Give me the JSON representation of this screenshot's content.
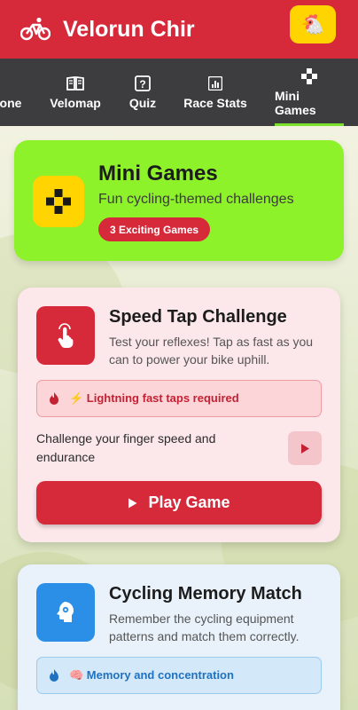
{
  "app": {
    "title": "Velorun Chir",
    "brand_icon": "bicycle-icon",
    "profile_icon": "chicken-icon"
  },
  "colors": {
    "header": "#d62a3b",
    "nav": "#3d3d3f",
    "accent_green": "#8ef22b",
    "accent_yellow": "#ffd400",
    "play_red": "#d62a3b",
    "memory_blue": "#2b8fe8"
  },
  "nav": {
    "tabs": [
      {
        "label": "one",
        "icon": "home-icon",
        "active": false
      },
      {
        "label": "Velomap",
        "icon": "book-map-icon",
        "active": false
      },
      {
        "label": "Quiz",
        "icon": "question-icon",
        "active": false
      },
      {
        "label": "Race Stats",
        "icon": "bar-chart-icon",
        "active": false
      },
      {
        "label": "Mini Games",
        "icon": "gamepad-icon",
        "active": true
      }
    ]
  },
  "hero": {
    "title": "Mini Games",
    "subtitle": "Fun cycling-themed challenges",
    "badge": "3 Exciting Games",
    "icon": "gamepad-icon"
  },
  "games": [
    {
      "title": "Speed Tap Challenge",
      "description": "Test your reflexes! Tap as fast as you can to power your bike uphill.",
      "icon": "tap-hand-icon",
      "feature": "⚡ Lightning fast taps required",
      "challenge": "Challenge your finger speed and endurance",
      "play_label": "Play Game"
    },
    {
      "title": "Cycling Memory Match",
      "description": "Remember the cycling equipment patterns and match them correctly.",
      "icon": "brain-head-icon",
      "feature": "🧠 Memory and concentration"
    }
  ]
}
